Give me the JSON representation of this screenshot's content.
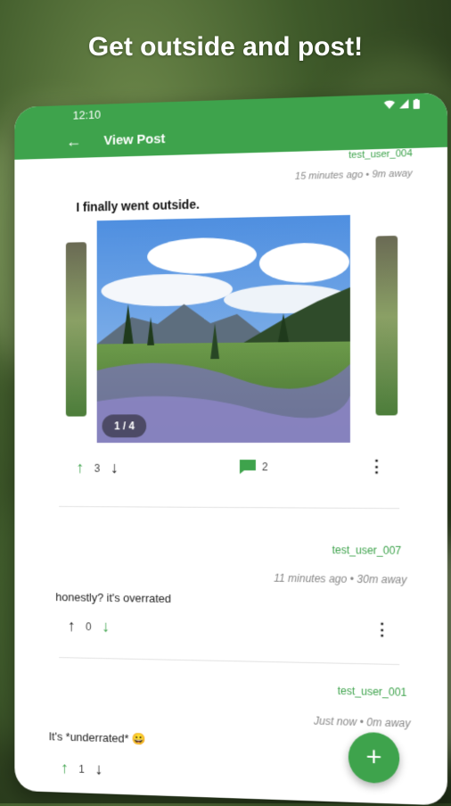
{
  "headline": "Get outside and post!",
  "status": {
    "time": "12:10"
  },
  "appbar": {
    "title": "View Post"
  },
  "post": {
    "username": "test_user_004",
    "meta": "15 minutes ago • 9m away",
    "title": "I finally went outside.",
    "image_counter": "1 / 4",
    "upvotes": "3",
    "comments": "2"
  },
  "comments": [
    {
      "username": "test_user_007",
      "meta": "11 minutes ago • 30m away",
      "text": "honestly? it's overrated",
      "votes": "0"
    },
    {
      "username": "test_user_001",
      "meta": "Just now • 0m away",
      "text": "It's *underrated* 😀",
      "votes": "1"
    }
  ],
  "fab": {
    "label": "+"
  },
  "colors": {
    "accent": "#3ea34c",
    "upvote_active": "#3ea34c"
  }
}
